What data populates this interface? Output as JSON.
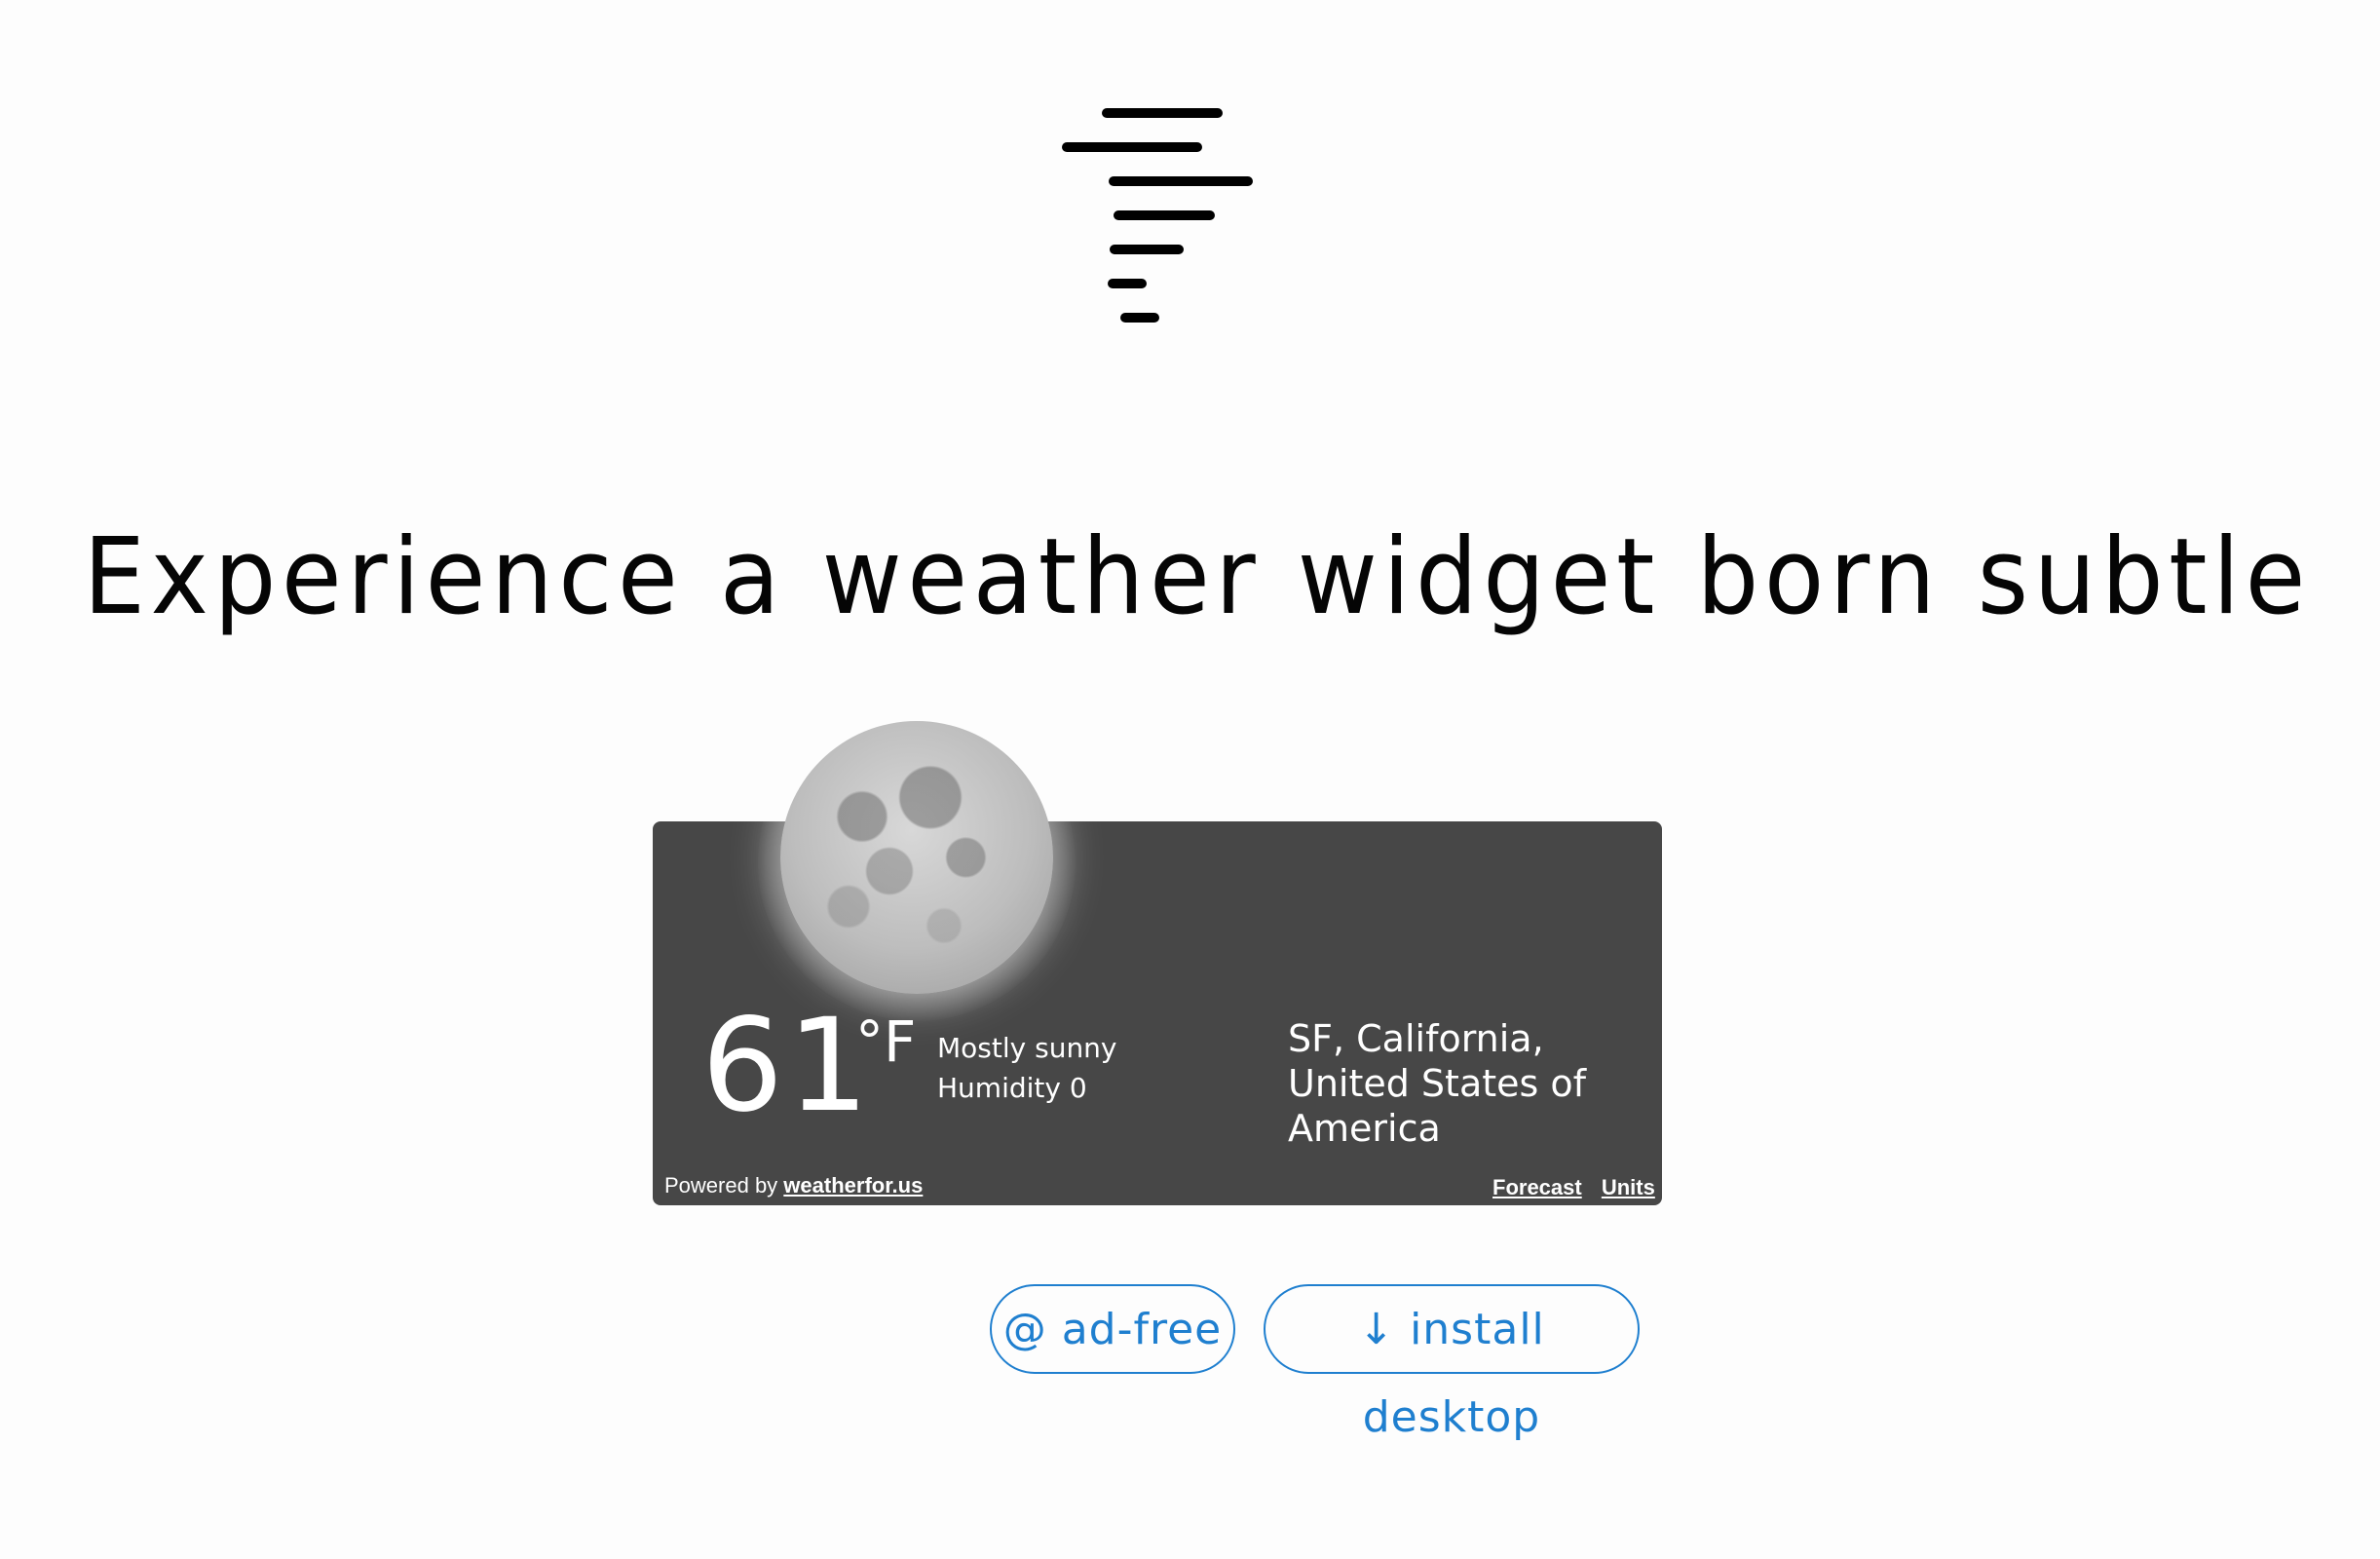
{
  "logo": {
    "icon": "tornado-lines-icon"
  },
  "headline": "Experience a weather widget born subtle",
  "widget": {
    "icon": "full-moon-icon",
    "temperature": "61",
    "unit": "°F",
    "condition": "Mostly sunny",
    "humidity": "Humidity 0",
    "location": "SF, California, United States of America",
    "powered_prefix": "Powered by ",
    "powered_link": "weatherfor.us",
    "forecast_link": "Forecast",
    "units_link": "Units",
    "background_color": "#474747"
  },
  "buttons": {
    "adfree": "@ ad-free",
    "install": "↓ install desktop",
    "accent_color": "#1f7fcf"
  }
}
